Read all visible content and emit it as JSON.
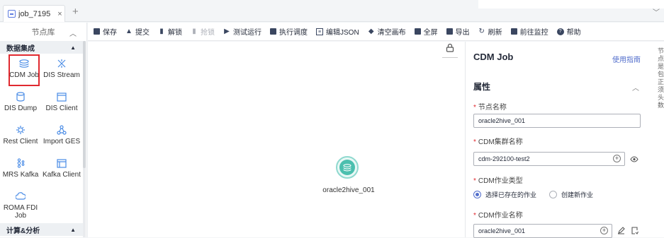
{
  "tabs": [
    {
      "label": "job_7195",
      "close": "×"
    }
  ],
  "tab_add": "+",
  "node_library": {
    "title": "节点库",
    "groups": [
      {
        "name": "数据集成",
        "nodes": [
          "CDM Job",
          "DIS Stream",
          "DIS Dump",
          "DIS Client",
          "Rest Client",
          "Import GES",
          "MRS Kafka",
          "Kafka Client",
          "ROMA FDI Job"
        ]
      },
      {
        "name": "计算&分析",
        "nodes": []
      }
    ]
  },
  "toolbar": {
    "save": "保存",
    "submit": "提交",
    "unlock": "解锁",
    "lock": "抢锁",
    "test_run": "测试运行",
    "schedule": "执行调度",
    "edit_json": "编辑JSON",
    "clear_canvas": "清空画布",
    "fullscreen": "全屏",
    "export": "导出",
    "refresh": "刷新",
    "monitor": "前往监控",
    "help": "帮助"
  },
  "canvas": {
    "node_label": "oracle2hive_001"
  },
  "properties": {
    "title": "CDM Job",
    "guide_link": "使用指南",
    "section": "属性",
    "node_name_label": "节点名称",
    "node_name_value": "oracle2hive_001",
    "cluster_label": "CDM集群名称",
    "cluster_value": "cdm-292100-test2",
    "job_type_label": "CDM作业类型",
    "job_type_options": [
      "选择已存在的作业",
      "创建新作业"
    ],
    "job_name_label": "CDM作业名称",
    "job_name_value": "oracle2hive_001"
  },
  "side_note": "节点是包 正须头数",
  "colors": {
    "accent": "#526ecc",
    "required": "#e0292f",
    "node_teal": "#4bbfae"
  }
}
